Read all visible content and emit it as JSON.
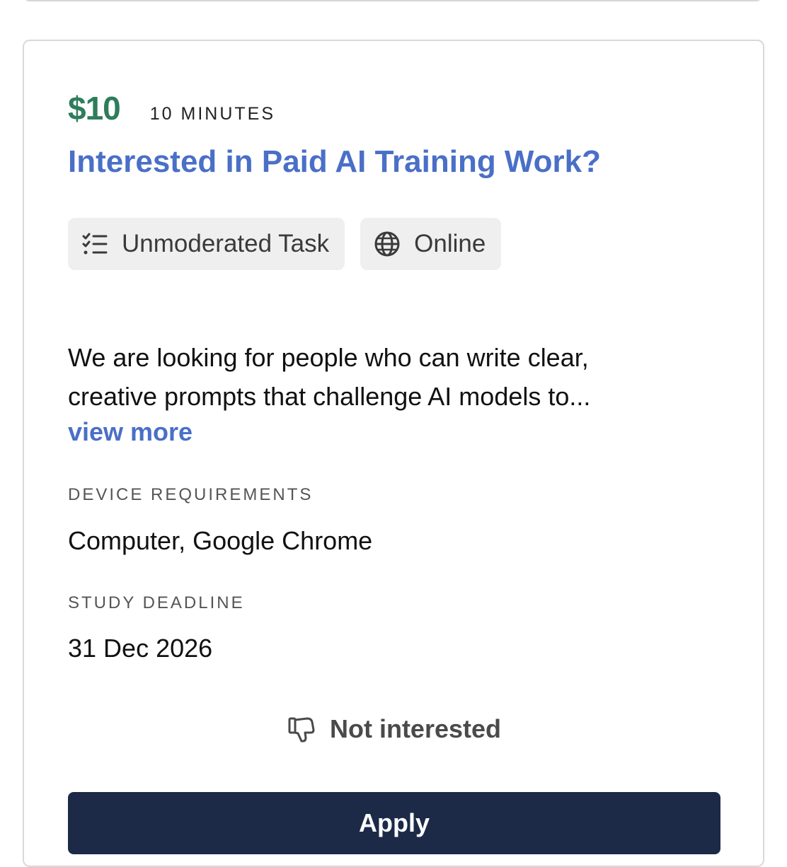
{
  "study": {
    "price": "$10",
    "duration": "10 MINUTES",
    "title": "Interested in Paid AI Training Work?",
    "tags": [
      {
        "label": "Unmoderated Task",
        "icon": "checklist-icon"
      },
      {
        "label": "Online",
        "icon": "globe-icon"
      }
    ],
    "description_lines": [
      "We are looking for people who can write clear,",
      "creative prompts that challenge AI models to..."
    ],
    "view_more_label": "view more",
    "device_requirements_label": "DEVICE REQUIREMENTS",
    "device_requirements": "Computer, Google Chrome",
    "deadline_label": "STUDY DEADLINE",
    "deadline": "31 Dec 2026"
  },
  "actions": {
    "not_interested_label": "Not interested",
    "not_interested_icon": "thumbs-down-icon",
    "apply_label": "Apply"
  },
  "colors": {
    "price": "#2e7d5b",
    "title": "#4a6fc7",
    "apply_button": "#1c2a48",
    "tag_background": "#efefef"
  }
}
